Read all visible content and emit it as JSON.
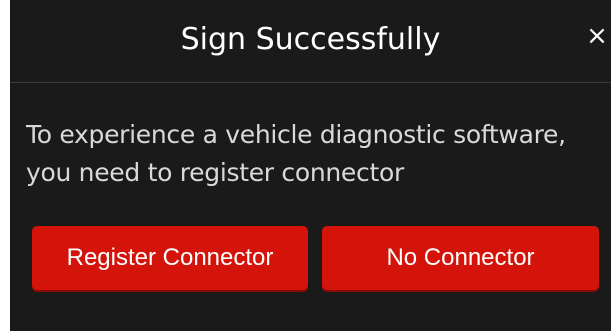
{
  "dialog": {
    "title": "Sign Successfully",
    "close_glyph": "×",
    "message": "To experience a vehicle diagnostic software, you need to register connector",
    "buttons": {
      "register_label": "Register Connector",
      "no_connector_label": "No Connector"
    }
  },
  "colors": {
    "background": "#1a1a1a",
    "accent": "#d4140a",
    "text": "#ffffff",
    "message_text": "#d9d9d9"
  }
}
